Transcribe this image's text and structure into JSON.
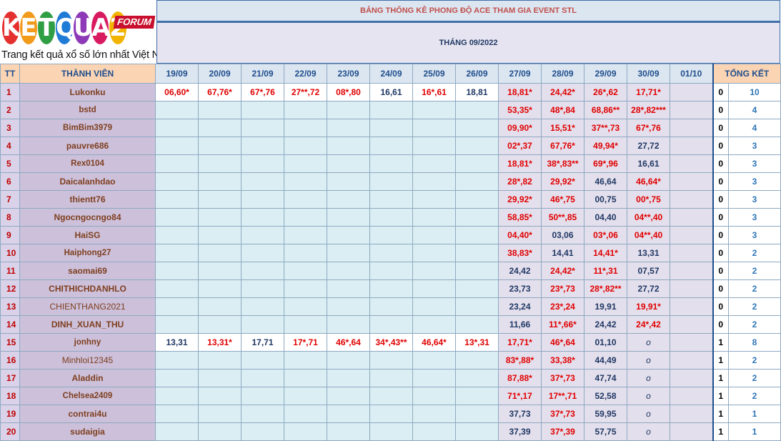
{
  "logo": {
    "letters": [
      "K",
      "E",
      "T",
      "Q",
      "U",
      "A",
      "2"
    ],
    "letter_colors": [
      "#e4302f",
      "#f29a1a",
      "#2f9e44",
      "#1f7bd6",
      "#8e3ab8",
      "#d81b60",
      "#f2b400"
    ],
    "forum": "FORUM",
    "tagline": "Trang kết quả xổ số lớn nhất Việt Nam"
  },
  "title": "BẢNG THỐNG KÊ PHONG ĐỘ ACE THAM GIA EVENT STL",
  "month": "THÁNG 09/2022",
  "headers": {
    "tt": "TT",
    "member": "THÀNH VIÊN",
    "dates": [
      "19/09",
      "20/09",
      "21/09",
      "22/09",
      "23/09",
      "24/09",
      "25/09",
      "26/09",
      "27/09",
      "28/09",
      "29/09",
      "30/09",
      "01/10"
    ],
    "total": "TỔNG KẾT"
  },
  "rows": [
    {
      "tt": "1",
      "name": "Lukonku",
      "cells": [
        "06,60*",
        "67,76*",
        "67*,76",
        "27**,72",
        "08*,80",
        "16,61",
        "16*,61",
        "18,81",
        "18,81*",
        "24,42*",
        "26*,62",
        "17,71*",
        ""
      ],
      "g": "0",
      "total": "10"
    },
    {
      "tt": "2",
      "name": "bstd",
      "cells": [
        "",
        "",
        "",
        "",
        "",
        "",
        "",
        "",
        "53,35*",
        "48*,84",
        "68,86**",
        "28*,82***",
        ""
      ],
      "g": "0",
      "total": "4"
    },
    {
      "tt": "3",
      "name": "BimBim3979",
      "cells": [
        "",
        "",
        "",
        "",
        "",
        "",
        "",
        "",
        "09,90*",
        "15,51*",
        "37**,73",
        "67*,76",
        ""
      ],
      "g": "0",
      "total": "4"
    },
    {
      "tt": "4",
      "name": "pauvre686",
      "cells": [
        "",
        "",
        "",
        "",
        "",
        "",
        "",
        "",
        "02*,37",
        "67,76*",
        "49,94*",
        "27,72",
        ""
      ],
      "g": "0",
      "total": "3"
    },
    {
      "tt": "5",
      "name": "Rex0104",
      "cells": [
        "",
        "",
        "",
        "",
        "",
        "",
        "",
        "",
        "18,81*",
        "38*,83**",
        "69*,96",
        "16,61",
        ""
      ],
      "g": "0",
      "total": "3"
    },
    {
      "tt": "6",
      "name": "Daicalanhdao",
      "cells": [
        "",
        "",
        "",
        "",
        "",
        "",
        "",
        "",
        "28*,82",
        "29,92*",
        "46,64",
        "46,64*",
        ""
      ],
      "g": "0",
      "total": "3"
    },
    {
      "tt": "7",
      "name": "thientt76",
      "cells": [
        "",
        "",
        "",
        "",
        "",
        "",
        "",
        "",
        "29,92*",
        "46*,75",
        "00,75",
        "00*,75",
        ""
      ],
      "g": "0",
      "total": "3"
    },
    {
      "tt": "8",
      "name": "Ngocngocngo84",
      "cells": [
        "",
        "",
        "",
        "",
        "",
        "",
        "",
        "",
        "58,85*",
        "50**,85",
        "04,40",
        "04**,40",
        ""
      ],
      "g": "0",
      "total": "3"
    },
    {
      "tt": "9",
      "name": "HaiSG",
      "cells": [
        "",
        "",
        "",
        "",
        "",
        "",
        "",
        "",
        "04,40*",
        "03,06",
        "03*,06",
        "04**,40",
        ""
      ],
      "g": "0",
      "total": "3"
    },
    {
      "tt": "10",
      "name": "Haiphong27",
      "cells": [
        "",
        "",
        "",
        "",
        "",
        "",
        "",
        "",
        "38,83*",
        "14,41",
        "14,41*",
        "13,31",
        ""
      ],
      "g": "0",
      "total": "2"
    },
    {
      "tt": "11",
      "name": "saomai69",
      "cells": [
        "",
        "",
        "",
        "",
        "",
        "",
        "",
        "",
        "24,42",
        "24,42*",
        "11*,31",
        "07,57",
        ""
      ],
      "g": "0",
      "total": "2"
    },
    {
      "tt": "12",
      "name": "CHITHICHDANHLO",
      "cells": [
        "",
        "",
        "",
        "",
        "",
        "",
        "",
        "",
        "23,73",
        "23*,73",
        "28*,82**",
        "27,72",
        ""
      ],
      "g": "0",
      "total": "2"
    },
    {
      "tt": "13",
      "name": "CHIENTHANG2021",
      "cells": [
        "",
        "",
        "",
        "",
        "",
        "",
        "",
        "",
        "23,24",
        "23*,24",
        "19,91",
        "19,91*",
        ""
      ],
      "g": "0",
      "total": "2"
    },
    {
      "tt": "14",
      "name": "DINH_XUAN_THU",
      "cells": [
        "",
        "",
        "",
        "",
        "",
        "",
        "",
        "",
        "11,66",
        "11*,66*",
        "24,42",
        "24*,42",
        ""
      ],
      "g": "0",
      "total": "2"
    },
    {
      "tt": "15",
      "name": "jonhny",
      "cells": [
        "13,31",
        "13,31*",
        "17,71",
        "17*,71",
        "46*,64",
        "34*,43**",
        "46,64*",
        "13*,31",
        "17,71*",
        "46*,64",
        "01,10",
        "o",
        ""
      ],
      "g": "1",
      "total": "8"
    },
    {
      "tt": "16",
      "name": "Minhloi12345",
      "cells": [
        "",
        "",
        "",
        "",
        "",
        "",
        "",
        "",
        "83*,88*",
        "33,38*",
        "44,49",
        "o",
        ""
      ],
      "g": "1",
      "total": "2"
    },
    {
      "tt": "17",
      "name": "Aladdin",
      "cells": [
        "",
        "",
        "",
        "",
        "",
        "",
        "",
        "",
        "87,88*",
        "37*,73",
        "47,74",
        "o",
        ""
      ],
      "g": "1",
      "total": "2"
    },
    {
      "tt": "18",
      "name": "Chelsea2409",
      "cells": [
        "",
        "",
        "",
        "",
        "",
        "",
        "",
        "",
        "71*,17",
        "17**,71",
        "52,58",
        "o",
        ""
      ],
      "g": "1",
      "total": "2"
    },
    {
      "tt": "19",
      "name": "contrai4u",
      "cells": [
        "",
        "",
        "",
        "",
        "",
        "",
        "",
        "",
        "37,73",
        "37*,73",
        "59,95",
        "o",
        ""
      ],
      "g": "1",
      "total": "1"
    },
    {
      "tt": "20",
      "name": "sudaigia",
      "cells": [
        "",
        "",
        "",
        "",
        "",
        "",
        "",
        "",
        "37,39",
        "37*,39",
        "57,75",
        "o",
        ""
      ],
      "g": "1",
      "total": "1"
    }
  ]
}
